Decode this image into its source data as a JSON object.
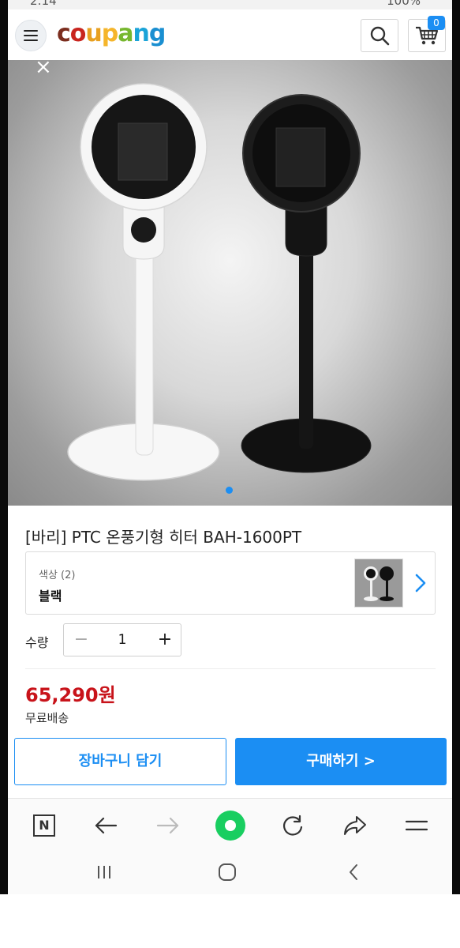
{
  "status_bar": {
    "time": "2:14",
    "battery": "100%"
  },
  "header": {
    "logo_letters": [
      "c",
      "o",
      "u",
      "p",
      "a",
      "n",
      "g"
    ],
    "logo_colors": [
      "#7b2d1e",
      "#c9251f",
      "#e8a020",
      "#f5b52b",
      "#77b72f",
      "#1aa3d8",
      "#1a8fd1"
    ],
    "cart_count": "0"
  },
  "hero": {
    "close_icon": "×",
    "icon": "close-icon"
  },
  "product": {
    "title": "[바리] PTC 온풍기형 히터 BAH-1600PT",
    "option_label": "색상 (2)",
    "option_value": "블랙",
    "quantity_label": "수량",
    "quantity_minus": "−",
    "quantity_value": "1",
    "quantity_plus": "+",
    "price": "65,290원",
    "shipping": "무료배송"
  },
  "actions": {
    "add_to_cart": "장바구니 담기",
    "buy_now": "구매하기 >"
  },
  "browser_bar": {
    "n_label": "N"
  },
  "colors": {
    "accent": "#1b8ef3",
    "price": "#c8131a",
    "naver_green": "#19ce60"
  }
}
